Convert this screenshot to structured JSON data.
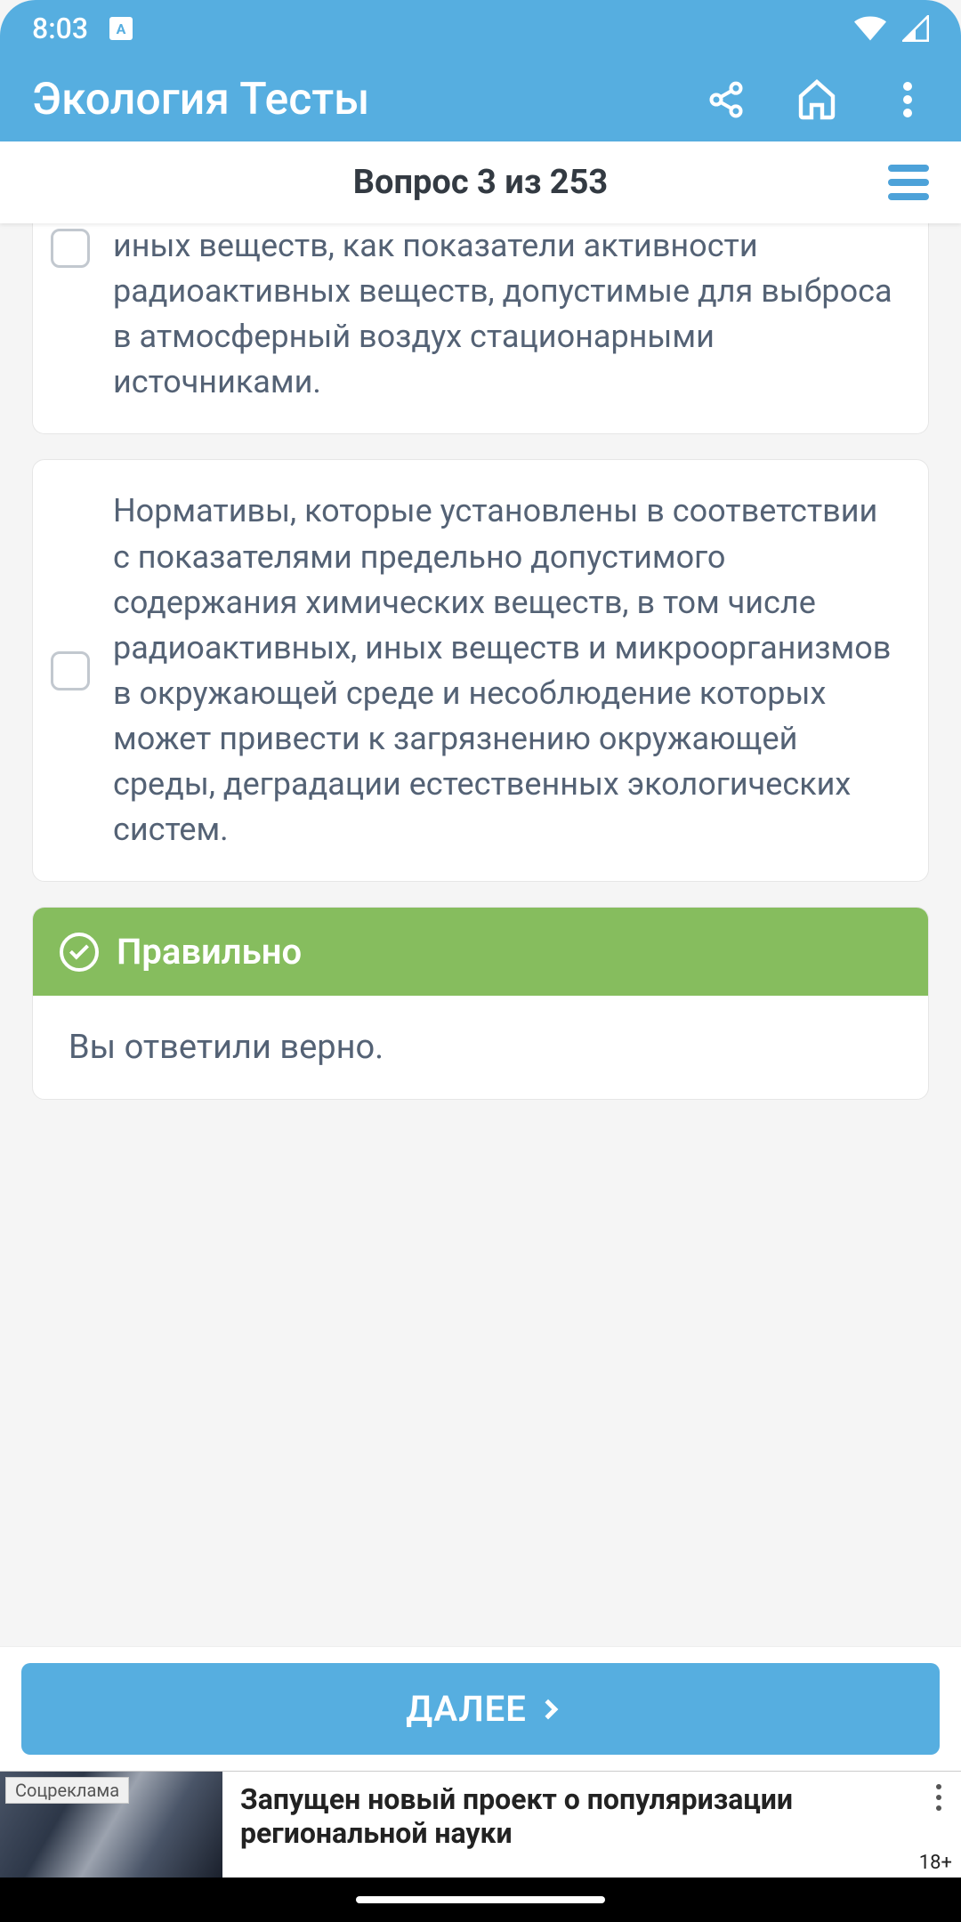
{
  "status": {
    "time": "8:03"
  },
  "app": {
    "title": "Экология Тесты"
  },
  "subheader": {
    "counter": "Вопрос 3 из 253"
  },
  "answers": [
    {
      "text": "иных веществ, как показатели активности радиоактивных веществ, допустимые для выброса в атмосферный воздух стационарными источниками.",
      "checked": false
    },
    {
      "text": "Нормативы, которые установлены в соответствии с показателями предельно допустимого содержания химических веществ, в том числе радиоактивных, иных веществ и микроорганизмов в окружающей среде и несоблюдение которых может привести к загрязнению окружающей среды, деградации естественных экологических систем.",
      "checked": false
    }
  ],
  "result": {
    "title": "Правильно",
    "body": "Вы ответили верно."
  },
  "next": {
    "label": "ДАЛЕЕ"
  },
  "ad": {
    "label": "Соцреклама",
    "text": "Запущен новый проект о популяризации региональной науки",
    "age": "18+"
  },
  "colors": {
    "primary": "#56aee0",
    "success": "#86bd5e",
    "text": "#546275"
  }
}
